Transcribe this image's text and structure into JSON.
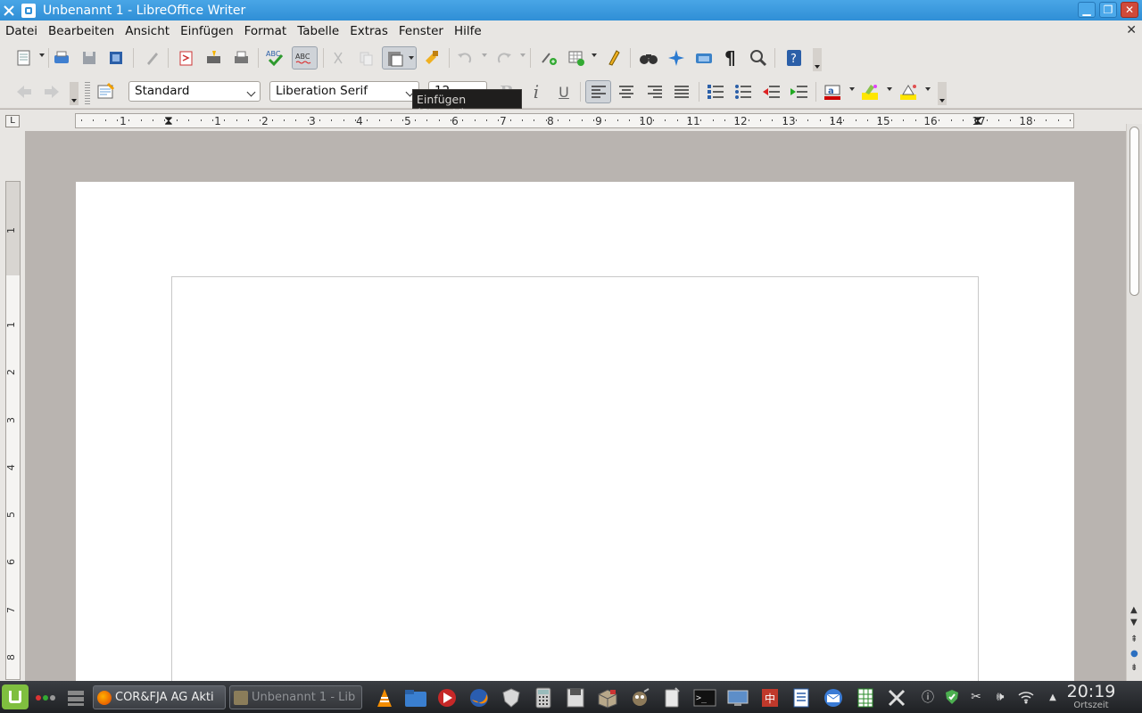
{
  "window": {
    "title": "Unbenannt 1 - LibreOffice Writer",
    "min_glyph": "▁",
    "max_glyph": "❐",
    "close_glyph": "✕"
  },
  "menu": {
    "items": [
      "Datei",
      "Bearbeiten",
      "Ansicht",
      "Einfügen",
      "Format",
      "Tabelle",
      "Extras",
      "Fenster",
      "Hilfe"
    ],
    "doc_close": "✕"
  },
  "formatting": {
    "paragraph_style": "Standard",
    "font_name": "Liberation Serif",
    "font_size": "12",
    "bold_glyph": "B",
    "italic_glyph": "i",
    "underline_glyph": "U"
  },
  "tooltip": {
    "text": "Einfügen (Strg+V)"
  },
  "ruler": {
    "tab_glyph": "L",
    "horizontal_numbers": [
      "1",
      "1",
      "2",
      "3",
      "4",
      "5",
      "6",
      "7",
      "8",
      "9",
      "10",
      "11",
      "12",
      "13",
      "14",
      "15",
      "16",
      "17",
      "18"
    ],
    "vertical_numbers": [
      "1",
      "1",
      "2",
      "3",
      "4",
      "5",
      "6",
      "7",
      "8"
    ]
  },
  "scrollbar": {
    "up": "▲",
    "down": "▼"
  },
  "taskbar": {
    "tasks": [
      {
        "label": "COR&FJA AG Akti",
        "active": true
      },
      {
        "label": "Unbenannt 1 - Lib",
        "active": false
      }
    ],
    "clock_time": "20:19",
    "clock_label": "Ortszeit"
  },
  "colors": {
    "title_bar": "#3b98dd",
    "toolbar_bg": "#e8e6e3",
    "doc_bg": "#b9b4b0",
    "page_bg": "#ffffff",
    "taskbar_bg": "#2a2c30"
  }
}
